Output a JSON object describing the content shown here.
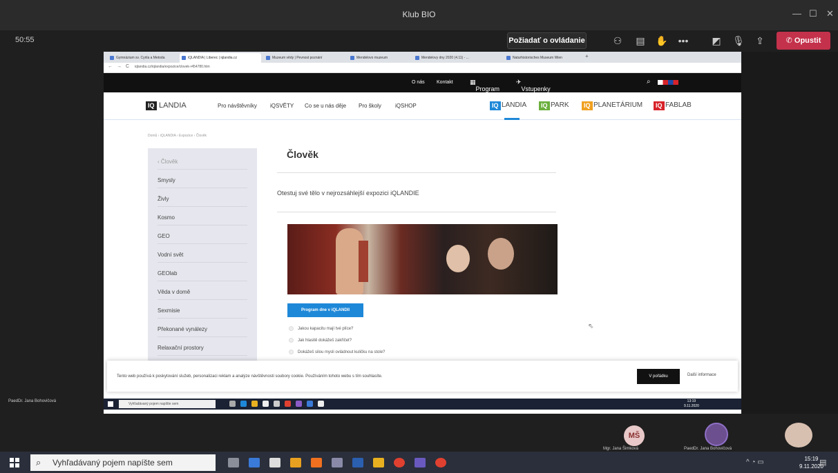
{
  "teams": {
    "title": "Klub BIO",
    "timer": "50:55",
    "request_control": "Požiadať o ovládanie",
    "leave": "Opustit",
    "presenter": "PaedDr. Jana Bohovičová",
    "participants": [
      {
        "initials": "MŠ",
        "name": "Mgr. Jana Šimková"
      },
      {
        "initials": "",
        "name": "PaedDr. Jana Bohovičová"
      }
    ]
  },
  "browser": {
    "tabs": [
      "Gymnázium sv. Cyrila a Metoda",
      "iQLANDIA | Liberec | iqlandia.cz",
      "Muzeum vědy | Pevnost poznání",
      "Mendelovo muzeum",
      "Mendelovy dny 2020 (4.11) - ...",
      "Naturhistorisches Museum Wien"
    ],
    "url": "iqlandia.cz/iqlandia/expozice/clovek-r454780.htm"
  },
  "site": {
    "top": {
      "about": "O nás",
      "contact": "Kontakt",
      "program": "Program",
      "tickets": "Vstupenky"
    },
    "logo_box": "IQ",
    "logo_text": "LANDIA",
    "nav": [
      "Pro návštěvníky",
      "iQSVĚTY",
      "Co se u nás děje",
      "Pro školy",
      "iQSHOP"
    ],
    "brands": [
      "LANDIA",
      "PARK",
      "PLANETÁRIUM",
      "FABLAB"
    ],
    "breadcrumb": "Domů › iQLANDIA › Expozice › Člověk",
    "menu": [
      "Člověk",
      "Smysly",
      "Živly",
      "Kosmo",
      "GEO",
      "Vodní svět",
      "GEOlab",
      "Věda v domě",
      "Sexmisie",
      "Překonané vynálezy",
      "Relaxační prostory"
    ],
    "title": "Člověk",
    "subtitle": "Otestuj své tělo v nejrozsáhlejší expozici iQLANDIE",
    "program_button": "Program dne v iQLANDII",
    "questions": [
      "Jakou kapacitu mají tvé plíce?",
      "Jak hlasitě dokážeš zakřičet?",
      "Dokážeš silou mysli ovládnout kuličku na stole?"
    ],
    "cookie_text": "Tento web používá k poskytování služeb, personalizaci reklam a analýze návštěvnosti soubory cookie. Používáním tohoto webu s tím souhlasíte.",
    "cookie_ok": "V pořádku",
    "cookie_more": "Další informace"
  },
  "shared_taskbar": {
    "search": "Vyhľadávaný pojem napíšte sem",
    "time": "13:19",
    "date": "9.11.2020"
  },
  "taskbar": {
    "search": "Vyhľadávaný pojem napíšte sem",
    "time": "15:19",
    "date": "9.11.2020"
  },
  "colors": {
    "accent": "#1e88d8",
    "leave": "#c4314b",
    "iq_blue": "#1e88d8",
    "iq_green": "#6bb03d",
    "iq_orange": "#f0a020",
    "iq_red": "#d8232a"
  }
}
